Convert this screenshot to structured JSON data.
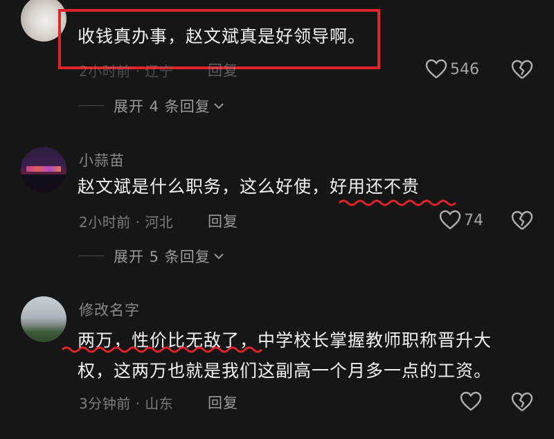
{
  "comments": [
    {
      "username": "",
      "text": "收钱真办事，赵文斌真是好领导啊。",
      "meta": "2小时前 · 辽宁",
      "reply_label": "回复",
      "like_count": "546",
      "expand_label": "展开 4 条回复",
      "highlight": "red-box"
    },
    {
      "username": "小蒜苗",
      "text_plain": "赵文斌是什么职务，这么好使，",
      "text_underlined": "好用还不贵",
      "meta": "2小时前 · 河北",
      "reply_label": "回复",
      "like_count": "74",
      "expand_label": "展开 5 条回复"
    },
    {
      "username": "修改名字",
      "line1_underlined": "两万，性价比无敌了，",
      "line1_rest": "中学校长掌握教师职称晋升大",
      "line2": "权，这两万也就是我们这副高一个月多一点的工资。",
      "meta": "3分钟前 · 山东",
      "reply_label": "回复",
      "like_count": ""
    }
  ],
  "colors": {
    "background": "#161616",
    "highlight_box": "#e0242b",
    "underline": "#e0242b"
  },
  "icons": [
    "heart-icon",
    "broken-heart-icon",
    "chevron-down-icon"
  ]
}
